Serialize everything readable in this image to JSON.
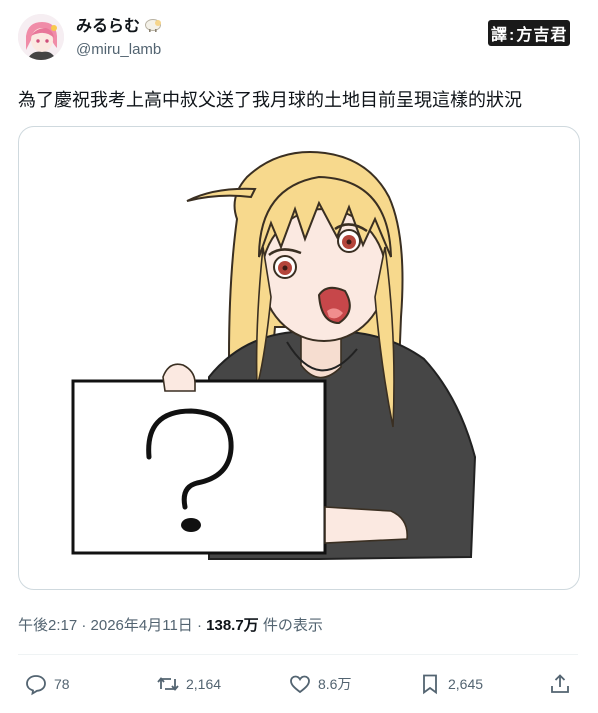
{
  "author": {
    "display_name": "みるらむ",
    "handle": "@miru_lamb"
  },
  "watermark": {
    "left": "譯",
    "right": "方吉君"
  },
  "tweet": {
    "text": "為了慶祝我考上高中叔父送了我月球的土地目前呈現這樣的狀況"
  },
  "meta": {
    "time_date": "午後2:17 · 2026年4月11日 · ",
    "views": "138.7万",
    "views_suffix": " 件の表示"
  },
  "actions": {
    "replies": "78",
    "reposts": "2,164",
    "likes": "8.6万",
    "bookmarks": "2,645"
  },
  "colors": {
    "text": "#0f1419",
    "muted": "#536471",
    "border": "#cfd9de"
  },
  "icons": [
    "reply-icon",
    "repost-icon",
    "like-icon",
    "bookmark-icon",
    "share-icon"
  ]
}
